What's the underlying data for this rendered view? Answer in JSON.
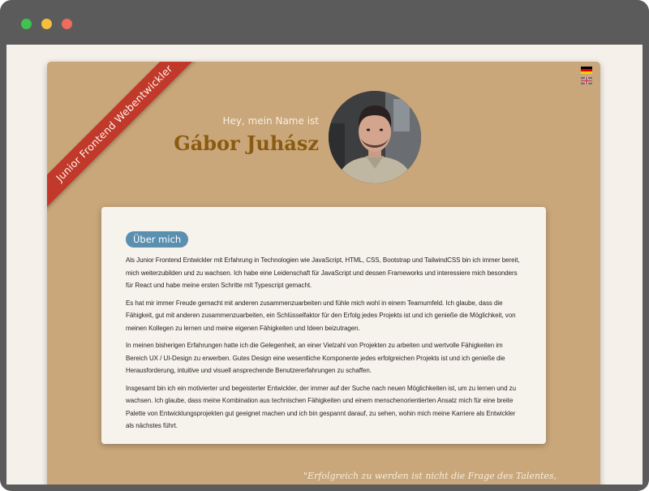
{
  "window": {
    "controls": [
      {
        "name": "maximize",
        "color": "#3fc34f"
      },
      {
        "name": "minimize",
        "color": "#f5be3d"
      },
      {
        "name": "close",
        "color": "#ef6a5f"
      }
    ]
  },
  "ribbon": {
    "text": "Junior Frontend Webentwickler",
    "color": "#c0392b"
  },
  "language": {
    "flags": [
      {
        "icon": "german-flag-icon",
        "lang": "de"
      },
      {
        "icon": "uk-flag-icon",
        "lang": "en"
      }
    ]
  },
  "hero": {
    "greeting": "Hey, mein Name ist",
    "name": "Gábor Juhász",
    "avatar_icon": "profile-photo"
  },
  "about": {
    "badge": "Über mich",
    "paragraphs": [
      "Als Junior Frontend Entwickler mit Erfahrung in Technologien wie JavaScript, HTML, CSS, Bootstrap und TailwindCSS bin ich immer bereit, mich weiterzubilden und zu wachsen. Ich habe eine Leidenschaft für JavaScript und dessen Frameworks und interessiere mich besonders für React und habe meine ersten Schritte mit Typescript gemacht.",
      "Es hat mir immer Freude gemacht mit anderen zusammenzuarbeiten und fühle mich wohl in einem Teamumfeld. Ich glaube, dass die Fähigkeit, gut mit anderen zusammenzuarbeiten, ein Schlüsselfaktor für den Erfolg jedes Projekts ist und ich genieße die Möglichkeit, von meinen Kollegen zu lernen und meine eigenen Fähigkeiten und Ideen beizutragen.",
      "In meinen bisherigen Erfahrungen hatte ich die Gelegenheit, an einer Vielzahl von Projekten zu arbeiten und wertvolle Fähigkeiten im Bereich UX / UI-Design zu erwerben. Gutes Design eine wesentliche Komponente jedes erfolgreichen Projekts ist und ich genieße die Herausforderung, intuitive und visuell ansprechende Benutzererfahrungen zu schaffen.",
      "Insgesamt bin ich ein motivierter und begeisterter Entwickler, der immer auf der Suche nach neuen Möglichkeiten ist, um zu lernen und zu wachsen. Ich glaube, dass meine Kombination aus technischen Fähigkeiten und einem menschenorientierten Ansatz mich für eine breite Palette von Entwicklungsprojekten gut geeignet machen und ich bin gespannt darauf, zu sehen, wohin mich meine Karriere als Entwickler als nächstes führt."
    ]
  },
  "quote": "\"Erfolgreich zu werden ist nicht die Frage des Talentes,",
  "colors": {
    "card": "#c9a77a",
    "name": "#8a5a10",
    "badge": "#5a8fb0",
    "background": "#f5f0ea"
  }
}
